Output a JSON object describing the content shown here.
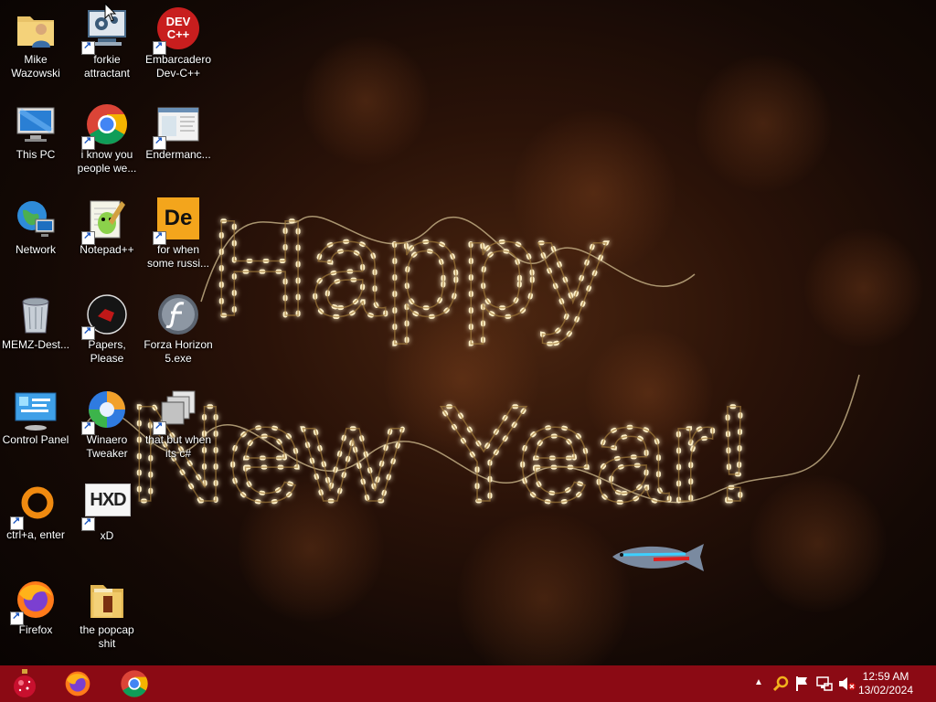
{
  "desktop": {
    "wallpaper": {
      "line1": "Happy",
      "line2": "New Year!"
    },
    "icons": [
      {
        "label": "Mike Wazowski",
        "icon": "user-folder-icon"
      },
      {
        "label": "forkie attractant",
        "icon": "computer-gear-icon"
      },
      {
        "label": "Embarcadero Dev-C++",
        "icon": "devcpp-icon",
        "icon_text": "DEV C++"
      },
      {
        "label": "This PC",
        "icon": "this-pc-icon"
      },
      {
        "label": "i know you people we...",
        "icon": "chrome-icon"
      },
      {
        "label": "Endermanc...",
        "icon": "document-window-icon"
      },
      {
        "label": "Network",
        "icon": "network-icon"
      },
      {
        "label": "Notepad++",
        "icon": "notepadpp-icon"
      },
      {
        "label": "for when some russi...",
        "icon": "de-icon",
        "icon_text": "De"
      },
      {
        "label": "MEMZ-Dest...",
        "icon": "recycle-bin-icon"
      },
      {
        "label": "Papers, Please",
        "icon": "papers-please-icon"
      },
      {
        "label": "Forza Horizon 5.exe",
        "icon": "flash-icon"
      },
      {
        "label": "Control Panel",
        "icon": "control-panel-icon"
      },
      {
        "label": "Winaero Tweaker",
        "icon": "winaero-icon"
      },
      {
        "label": "that but when its c#",
        "icon": "stacked-windows-icon"
      },
      {
        "label": "ctrl+a, enter",
        "icon": "orange-ring-icon"
      },
      {
        "label": "xD",
        "icon": "hxd-icon",
        "icon_text": "HXD"
      },
      {
        "label": "Firefox",
        "icon": "firefox-icon"
      },
      {
        "label": "the popcap shit",
        "icon": "popcap-folder-icon"
      }
    ]
  },
  "taskbar": {
    "start_icon": "ornament-start-icon",
    "pinned": [
      {
        "name": "Firefox",
        "icon": "firefox-icon"
      },
      {
        "name": "Google Chrome",
        "icon": "chrome-icon"
      }
    ],
    "tray": {
      "icons": [
        "chevron-up-icon",
        "search-icon",
        "flag-icon",
        "network-icon",
        "volume-muted-icon"
      ],
      "time": "12:59 AM",
      "date": "13/02/2024"
    }
  },
  "colors": {
    "taskbar": "#8b0a14",
    "light_bulbs": "#ffe9a8"
  }
}
